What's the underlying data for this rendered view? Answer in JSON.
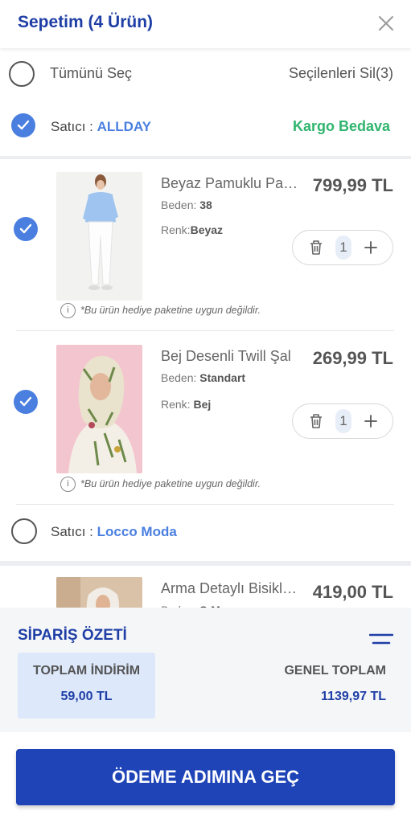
{
  "header": {
    "title": "Sepetim (4 Ürün)",
    "close_icon": "close-icon"
  },
  "select_all": {
    "label": "Tümünü Seç",
    "delete_selected": "Seçilenleri Sil(3)"
  },
  "sellers": [
    {
      "prefix": "Satıcı : ",
      "name": "ALLDAY",
      "shipping": "Kargo Bedava",
      "checked": true
    },
    {
      "prefix": "Satıcı : ",
      "name": "Locco Moda",
      "checked": false
    }
  ],
  "products": [
    {
      "name": "Beyaz Pamuklu Pantolon",
      "price": "799,99 TL",
      "size_label": "Beden:",
      "size": "38",
      "color_label": "Renk:",
      "color": "Beyaz",
      "qty": "1",
      "note": "*Bu ürün hediye paketine uygun değildir.",
      "checked": true
    },
    {
      "name": "Bej Desenli Twill Şal",
      "price": "269,99 TL",
      "size_label": "Beden:",
      "size": "Standart",
      "color_label": "Renk:",
      "color": "Bej",
      "qty": "1",
      "note": "*Bu ürün hediye paketine uygun değildir.",
      "checked": true
    },
    {
      "name": "Arma Detaylı Bisiklet Yaka",
      "price": "419,00 TL",
      "size_label": "Beden:",
      "size": "S-M"
    }
  ],
  "summary": {
    "title": "SİPARİŞ ÖZETİ",
    "discount_label": "TOPLAM İNDİRİM",
    "discount_value": "59,00 TL",
    "total_label": "GENEL TOPLAM",
    "total_value": "1139,97 TL"
  },
  "cta": {
    "label": "ÖDEME ADIMINA GEÇ"
  },
  "colors": {
    "brand": "#1f3fa6",
    "accent": "#4a7fe0",
    "success": "#2fb56e",
    "cta": "#1e44b8"
  }
}
